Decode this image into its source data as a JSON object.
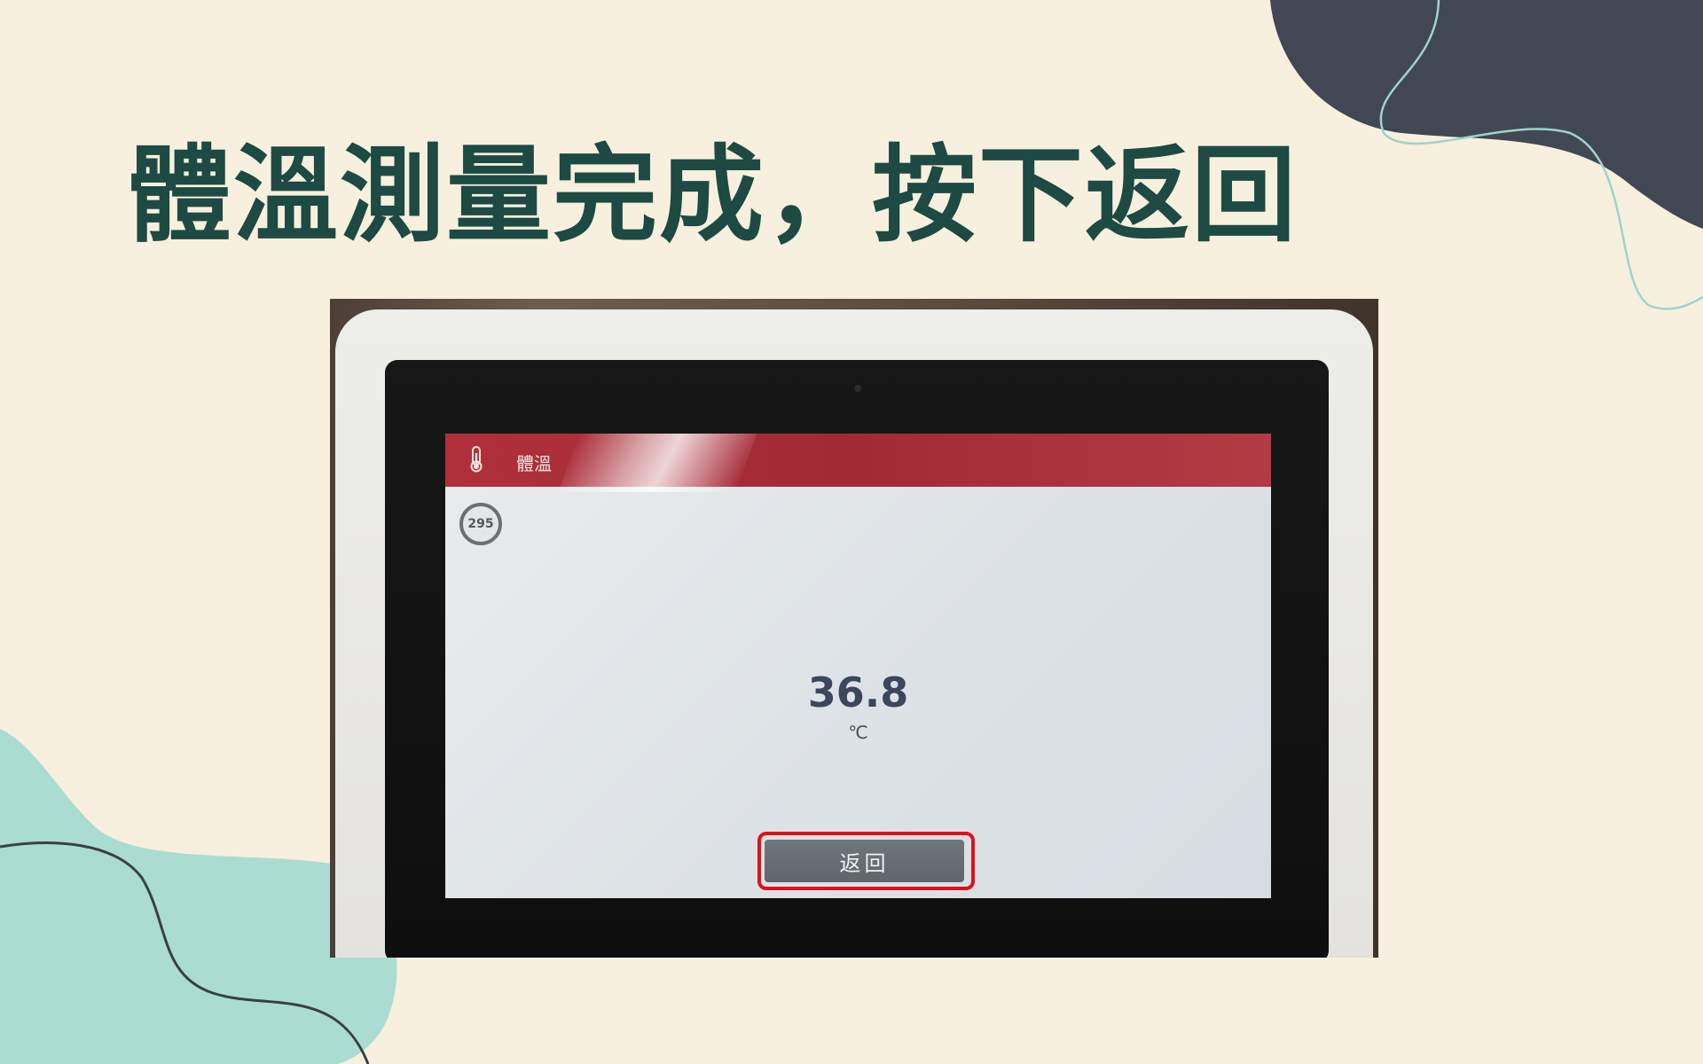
{
  "slide": {
    "headline": "體溫測量完成，按下返回",
    "colors": {
      "background": "#f7f0de",
      "headline": "#1d4a43",
      "blob_dark": "#414753",
      "blob_teal": "#abdcd2",
      "highlight": "#e0101a"
    }
  },
  "kiosk": {
    "header": {
      "icon": "thermometer-icon",
      "title": "體溫",
      "color": "#b0303a"
    },
    "countdown": "295",
    "temperature": {
      "value": "36.8",
      "unit": "℃"
    },
    "back_button_label": "返回"
  }
}
